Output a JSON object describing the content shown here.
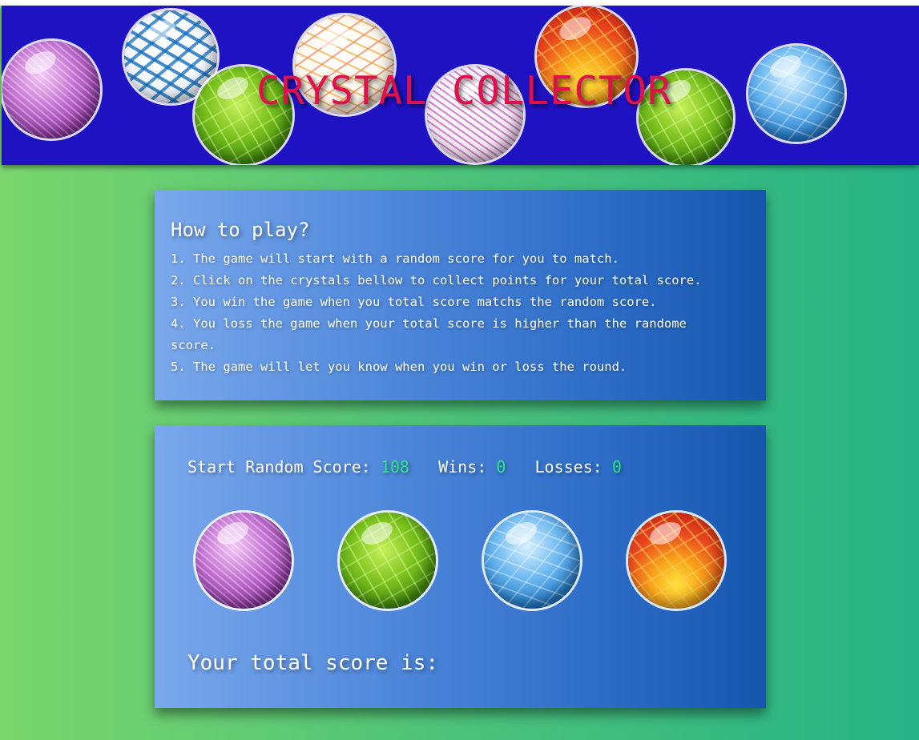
{
  "header": {
    "title": "CRYSTAL COLLECTOR",
    "decor_crystals": [
      "purple-crystal",
      "white-blue-crystal",
      "green-crystal",
      "white-orange-crystal",
      "white-purple-crystal",
      "red-crystal",
      "green-crystal",
      "blue-crystal"
    ]
  },
  "rules": {
    "title": "How to play?",
    "items": [
      "1. The game will start with a random score for you to match.",
      "2. Click on the crystals bellow to collect points for your total score.",
      "3. You win the game when you total score matchs the random score.",
      "4. You loss the game when your total score is higher than the randome score.",
      "5. The game will let you know when you win or loss the round."
    ]
  },
  "game": {
    "random_label": "Start Random Score:",
    "random_value": "108",
    "wins_label": "Wins:",
    "wins_value": "0",
    "losses_label": "Losses:",
    "losses_value": "0",
    "crystals": [
      "purple-crystal",
      "green-crystal",
      "blue-crystal",
      "red-crystal"
    ],
    "total_label": "Your total score is:",
    "total_value": ""
  },
  "colors": {
    "header_bg": "#1f12c2",
    "title": "#e0104a",
    "stat_value": "#2ee68a",
    "page_gradient_start": "#7ad66c",
    "page_gradient_end": "#26b386"
  }
}
